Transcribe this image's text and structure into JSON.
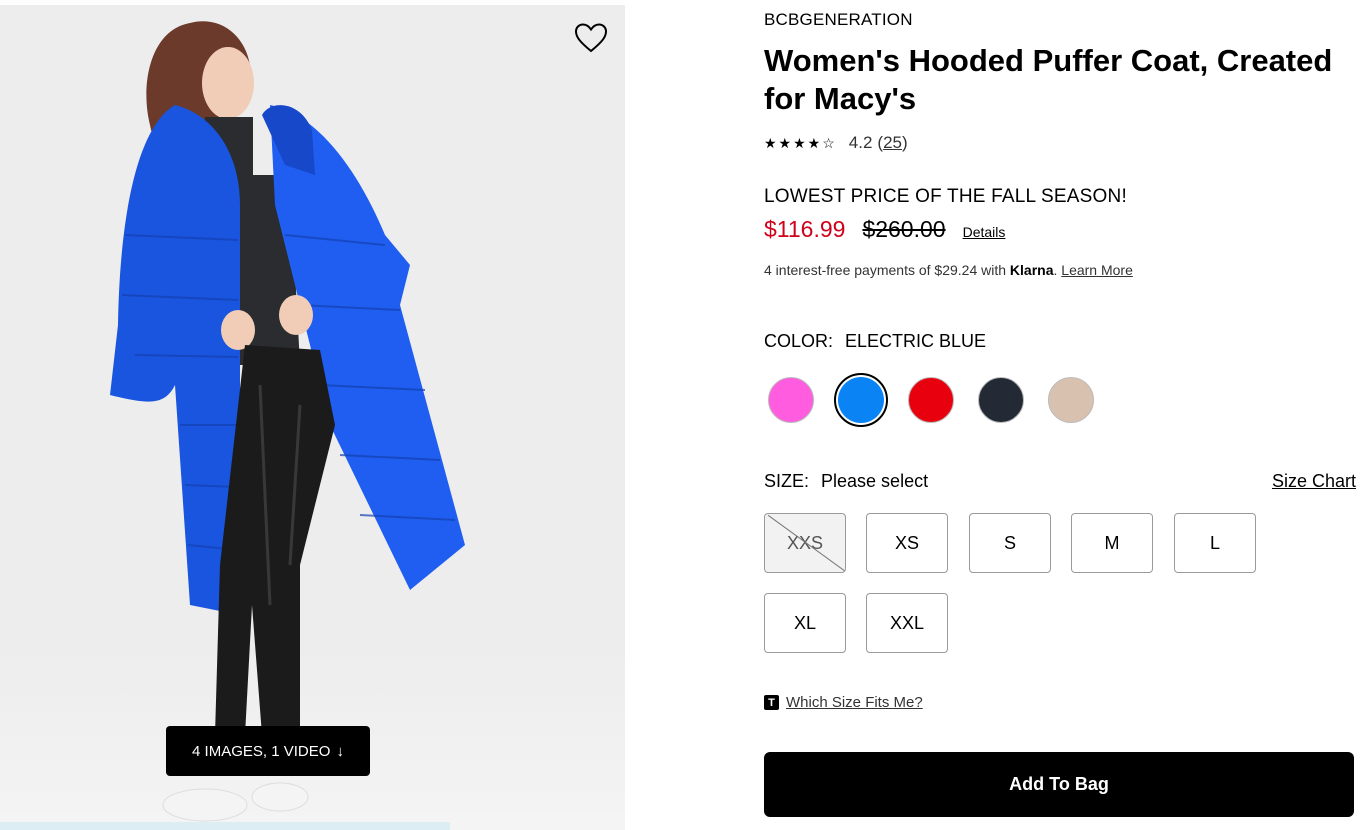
{
  "media": {
    "badge_label": "4 IMAGES, 1 VIDEO",
    "badge_arrow": "↓",
    "photo_icon": "model-wearing-coat-photo",
    "favorite_icon": "heart-outline-icon"
  },
  "product": {
    "brand": "BCBGENERATION",
    "title": "Women's Hooded Puffer Coat, Created for Macy's",
    "stars": "★★★★☆",
    "rating_value": "4.2",
    "rating_open": "(",
    "review_count": "25",
    "rating_close": ")"
  },
  "pricing": {
    "promo": "LOWEST PRICE OF THE FALL SEASON!",
    "sale_price": "$116.99",
    "original_price": "$260.00",
    "details_label": "Details",
    "sale_color": "#d0021b"
  },
  "klarna": {
    "prefix": "4 interest-free payments of $29.24 with ",
    "brand": "Klarna",
    "dot": ". ",
    "learn_more": "Learn More"
  },
  "color": {
    "label": "COLOR:",
    "selected": "ELECTRIC BLUE",
    "swatches": [
      {
        "name": "pink",
        "hex": "#ff5ce0"
      },
      {
        "name": "electric-blue",
        "hex": "#0a84f5",
        "selected": true
      },
      {
        "name": "red",
        "hex": "#e8000f"
      },
      {
        "name": "navy",
        "hex": "#232a35"
      },
      {
        "name": "beige",
        "hex": "#d9c1b0"
      }
    ]
  },
  "size": {
    "label": "SIZE:",
    "selected": "Please select",
    "chart_label": "Size Chart",
    "options": [
      {
        "label": "XXS",
        "available": false
      },
      {
        "label": "XS",
        "available": true
      },
      {
        "label": "S",
        "available": true
      },
      {
        "label": "M",
        "available": true
      },
      {
        "label": "L",
        "available": true
      },
      {
        "label": "XL",
        "available": true
      },
      {
        "label": "XXL",
        "available": true
      }
    ]
  },
  "fit": {
    "icon_letter": "T",
    "link": "Which Size Fits Me?"
  },
  "cart": {
    "add_to_bag": "Add To Bag"
  }
}
